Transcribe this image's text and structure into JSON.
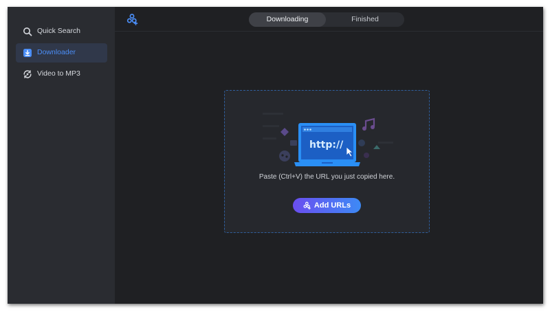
{
  "sidebar": {
    "items": [
      {
        "label": "Quick Search",
        "icon": "search-icon",
        "active": false
      },
      {
        "label": "Downloader",
        "icon": "download-icon",
        "active": true
      },
      {
        "label": "Video to MP3",
        "icon": "convert-icon",
        "active": false
      }
    ]
  },
  "header": {
    "add_icon": "add-link-icon",
    "tabs": [
      {
        "label": "Downloading",
        "active": true
      },
      {
        "label": "Finished",
        "active": false
      }
    ]
  },
  "main": {
    "illustration": {
      "url_text": "http://"
    },
    "hint": "Paste (Ctrl+V) the URL you just copied here.",
    "add_button_label": "Add URLs"
  },
  "colors": {
    "background": "#1f2023",
    "sidebar": "#2a2c31",
    "accent": "#4b8ef7",
    "button_gradient_start": "#6a4ef0",
    "button_gradient_end": "#3d8af5"
  }
}
